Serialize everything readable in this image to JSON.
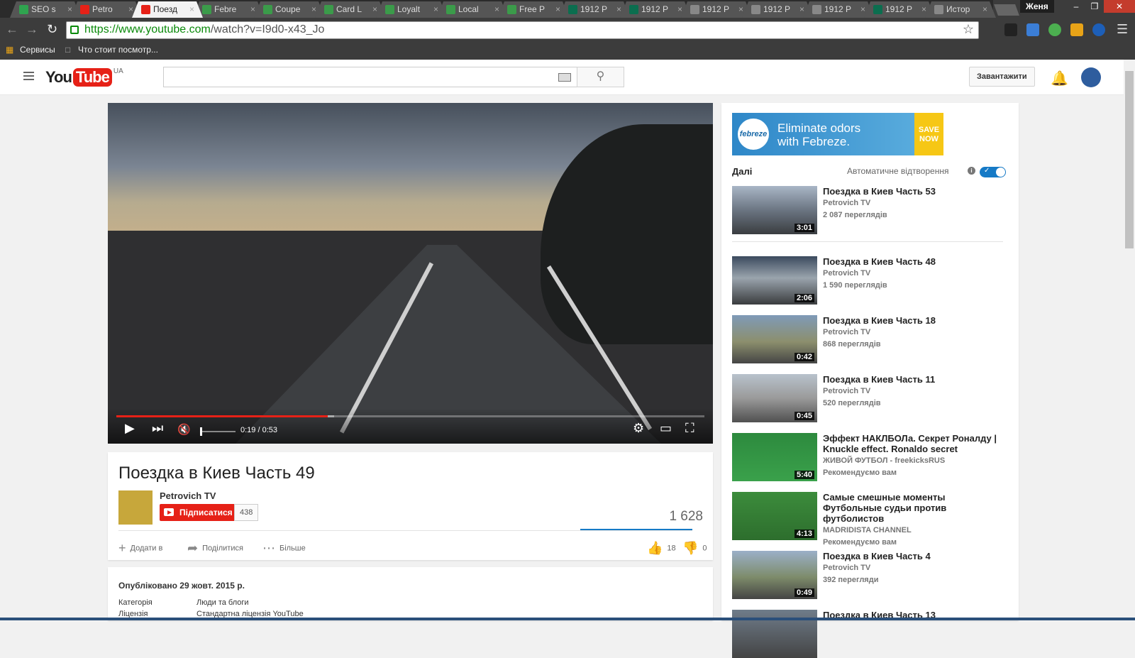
{
  "browser": {
    "tabs": [
      {
        "label": "SEO s",
        "fav": "#2fa44f"
      },
      {
        "label": "Petro",
        "fav": "#e62117"
      },
      {
        "label": "Поезд",
        "fav": "#e62117",
        "active": true
      },
      {
        "label": "Febre",
        "fav": "#3b9b4a"
      },
      {
        "label": "Coupe",
        "fav": "#3b9b4a"
      },
      {
        "label": "Card L",
        "fav": "#3b9b4a"
      },
      {
        "label": "Loyalt",
        "fav": "#3b9b4a"
      },
      {
        "label": "Local",
        "fav": "#3b9b4a"
      },
      {
        "label": "Free P",
        "fav": "#3b9b4a"
      },
      {
        "label": "1912 P",
        "fav": "#0b6e4f"
      },
      {
        "label": "1912 P",
        "fav": "#0b6e4f"
      },
      {
        "label": "1912 P",
        "fav": "#888888"
      },
      {
        "label": "1912 P",
        "fav": "#888888"
      },
      {
        "label": "1912 P",
        "fav": "#888888"
      },
      {
        "label": "1912 P",
        "fav": "#0b6e4f"
      },
      {
        "label": "Истор",
        "fav": "#888888"
      }
    ],
    "user": "Женя",
    "url_host": "https://www.youtube.com",
    "url_path": "/watch?v=I9d0-x43_Jo",
    "bookmarks": {
      "apps": "Сервисы",
      "item": "Что стоит посмотр..."
    }
  },
  "yt": {
    "region": "UA",
    "upload": "Завантажити",
    "logo_you": "You",
    "logo_tube": "Tube"
  },
  "player": {
    "time": "0:19 / 0:53",
    "progress": 0.36,
    "buffered": 0.37
  },
  "video": {
    "title": "Поездка в Киев Часть 49",
    "channel": "Petrovich TV",
    "subscribe": "Підписатися",
    "subscribers": "438",
    "views": "1 628",
    "add_to": "Додати в",
    "share": "Поділитися",
    "more": "Більше",
    "likes": "18",
    "dislikes": "0",
    "published": "Опубліковано 29 жовт. 2015 р.",
    "category_label": "Категорія",
    "category_value": "Люди та блоги",
    "license_label": "Ліцензія",
    "license_value": "Стандартна ліцензія YouTube"
  },
  "ad": {
    "brand": "febreze",
    "text1": "Eliminate odors",
    "text2": "with Febreze.",
    "cta1": "SAVE",
    "cta2": "NOW"
  },
  "sidebar": {
    "next": "Далі",
    "autoplay": "Автоматичне відтворення",
    "items": [
      {
        "title": "Поездка в Киев Часть 53",
        "channel": "Petrovich TV",
        "views": "2 087 переглядів",
        "dur": "3:01"
      },
      {
        "title": "Поездка в Киев Часть 48",
        "channel": "Petrovich TV",
        "views": "1 590 переглядів",
        "dur": "2:06"
      },
      {
        "title": "Поездка в Киев Часть 18",
        "channel": "Petrovich TV",
        "views": "868 переглядів",
        "dur": "0:42"
      },
      {
        "title": "Поездка в Киев Часть 11",
        "channel": "Petrovich TV",
        "views": "520 переглядів",
        "dur": "0:45"
      },
      {
        "title": "Эффект НАКЛБОЛа. Секрет Роналду | Knuckle effect. Ronaldo secret",
        "channel": "ЖИВОЙ ФУТБОЛ - freekicksRUS",
        "views": "Рекомендуємо вам",
        "dur": "5:40"
      },
      {
        "title": "Самые смешные моменты Футбольные судьи против футболистов",
        "channel": "MADRIDISTA CHANNEL",
        "views": "Рекомендуємо вам",
        "dur": "4:13"
      },
      {
        "title": "Поездка в Киев Часть 4",
        "channel": "Petrovich TV",
        "views": "392 перегляди",
        "dur": "0:49"
      },
      {
        "title": "Поездка в Киев Часть 13",
        "channel": "",
        "views": "",
        "dur": ""
      }
    ]
  }
}
